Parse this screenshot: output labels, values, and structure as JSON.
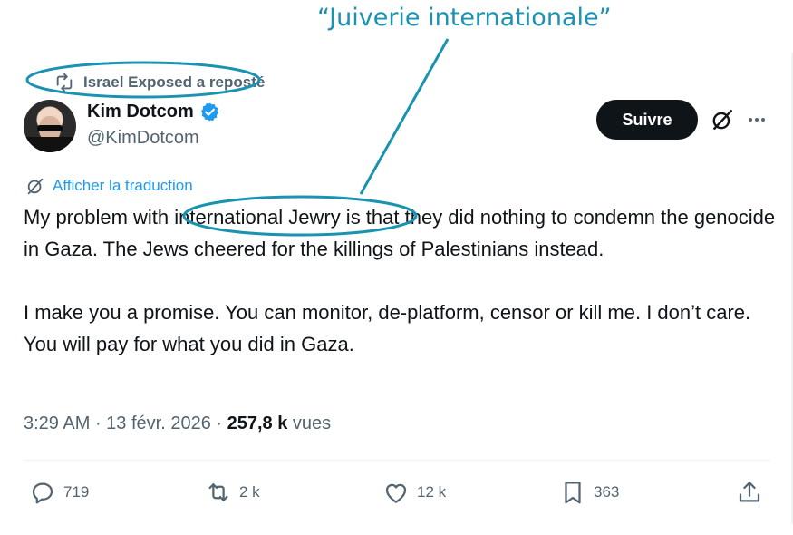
{
  "annotation": {
    "title": "“Juiverie internationale”",
    "color": "#1a93b0"
  },
  "repost": {
    "icon": "repost-icon",
    "text": "Israel Exposed a reposté"
  },
  "author": {
    "name": "Kim Dotcom",
    "handle": "@KimDotcom",
    "verified_icon": "verified-badge-icon",
    "avatar": "profile-photo"
  },
  "follow_button": {
    "label": "Suivre"
  },
  "grok_icon": "grok-icon",
  "more_icon": "more-options-icon",
  "translate": {
    "icon": "grok-icon",
    "label": "Afficher la traduction"
  },
  "tweet": {
    "paragraph1": "My problem with international Jewry is that they did nothing to condemn the genocide in Gaza. The Jews cheered for the killings of Palestinians instead.",
    "paragraph2": "I make you a promise. You can monitor, de-platform, censor or kill me. I don’t care. You will pay for what you did in Gaza."
  },
  "meta": {
    "time": "3:29 AM",
    "separator": " · ",
    "date": "13 févr. 2026",
    "views_count": "257,8 k",
    "views_label": " vues"
  },
  "actions": {
    "replies": {
      "icon": "reply-icon",
      "count": "719"
    },
    "reposts": {
      "icon": "repost-icon",
      "count": "2 k"
    },
    "likes": {
      "icon": "heart-icon",
      "count": "12 k"
    },
    "bookmarks": {
      "icon": "bookmark-icon",
      "count": "363"
    },
    "share": {
      "icon": "share-icon"
    }
  },
  "colors": {
    "text": "#0f1419",
    "secondary": "#536471",
    "link": "#1d9bf0",
    "verified": "#1d9bf0",
    "annotation": "#1a93b0"
  }
}
